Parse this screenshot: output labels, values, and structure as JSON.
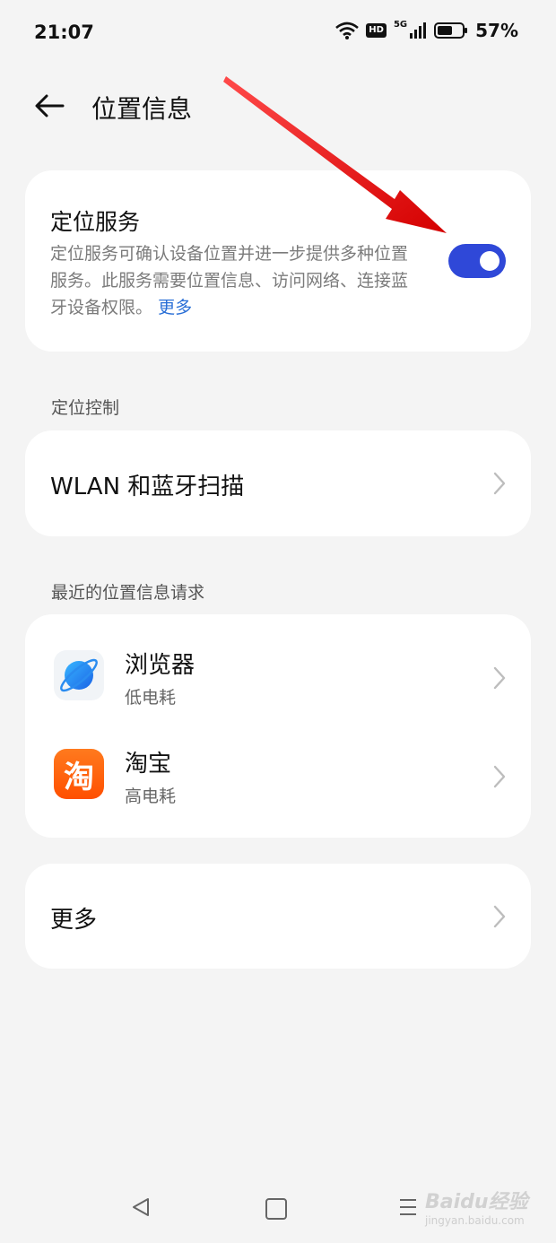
{
  "status": {
    "time": "21:07",
    "hd": "HD",
    "network": "5G",
    "battery": "57%"
  },
  "header": {
    "title": "位置信息"
  },
  "location_service": {
    "title": "定位服务",
    "description": "定位服务可确认设备位置并进一步提供多种位置服务。此服务需要位置信息、访问网络、连接蓝牙设备权限。",
    "more_link": "更多",
    "enabled": true
  },
  "sections": {
    "control_label": "定位控制",
    "recent_label": "最近的位置信息请求"
  },
  "wlan_row": {
    "title": "WLAN 和蓝牙扫描"
  },
  "recent_requests": [
    {
      "name": "浏览器",
      "usage": "低电耗",
      "icon": "browser-icon"
    },
    {
      "name": "淘宝",
      "usage": "高电耗",
      "icon": "taobao-icon",
      "icon_glyph": "淘"
    }
  ],
  "more_row": {
    "title": "更多"
  },
  "watermark": {
    "brand": "Baidu经验",
    "url": "jingyan.baidu.com"
  },
  "colors": {
    "toggle_on": "#2f48d8",
    "link": "#2a6fd6",
    "annotation_arrow": "#e8121b"
  }
}
